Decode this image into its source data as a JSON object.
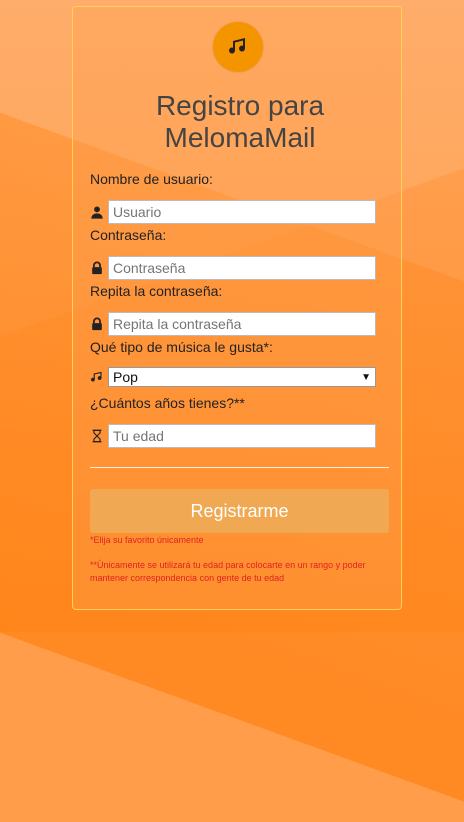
{
  "colors": {
    "accent": "#f49500",
    "button_bg": "#f0a952",
    "card_border": "#ffd257",
    "note_text": "#e12222"
  },
  "logo": {
    "icon": "music-note-icon"
  },
  "form": {
    "title_line1": "Registro para",
    "title_line2": "MelomaMail",
    "username": {
      "label": "Nombre de usuario:",
      "placeholder": "Usuario",
      "icon": "user-icon"
    },
    "password": {
      "label": "Contraseña:",
      "placeholder": "Contraseña",
      "icon": "lock-icon"
    },
    "repeat_password": {
      "label": "Repita la contraseña:",
      "placeholder": "Repita la contraseña",
      "icon": "lock-icon"
    },
    "music": {
      "label": "Qué tipo de música le gusta*:",
      "selected": "Pop",
      "icon": "music-note-icon"
    },
    "age": {
      "label": "¿Cuántos años tienes?**",
      "placeholder": "Tu edad",
      "icon": "hourglass-icon"
    },
    "submit_label": "Registrarme",
    "note1": "*Elija su favorito únicamente",
    "note2": "**Únicamente se utilizará tu edad para colocarte en un rango y poder mantener correspondencia con gente de tu edad"
  }
}
